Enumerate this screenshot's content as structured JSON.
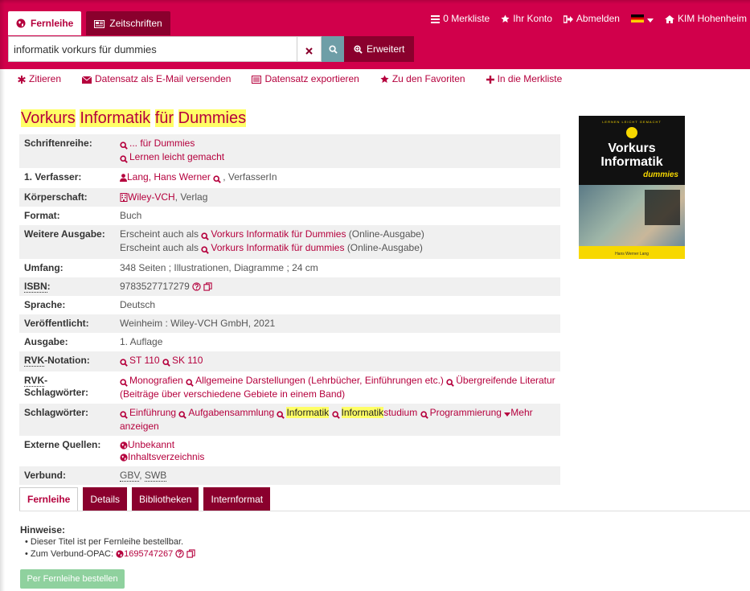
{
  "header": {
    "tab_fernleihe": "Fernleihe",
    "tab_zeitschriften": "Zeitschriften",
    "merkliste": "0 Merkliste",
    "konto": "Ihr Konto",
    "abmelden": "Abmelden",
    "kim": "KIM Hohenheim"
  },
  "search": {
    "value": "informatik vorkurs für dummies",
    "advanced": "Erweitert"
  },
  "actions": {
    "zitieren": "Zitieren",
    "email": "Datensatz als E-Mail versenden",
    "export": "Datensatz exportieren",
    "favoriten": "Zu den Favoriten",
    "merkliste": "In die Merkliste"
  },
  "title": {
    "w1": "Vorkurs",
    "w2": "Informatik",
    "w3": "für",
    "w4": "Dummies"
  },
  "record": {
    "schriftenreihe_label": "Schriftenreihe:",
    "schriftenreihe_1": "... für Dummies",
    "schriftenreihe_2": "Lernen leicht gemacht",
    "verfasser_label": "1. Verfasser:",
    "verfasser_name": "Lang, Hans Werner",
    "verfasser_role": ", VerfasserIn",
    "koerperschaft_label": "Körperschaft:",
    "koerperschaft_name": "Wiley-VCH",
    "koerperschaft_role": ", Verlag",
    "format_label": "Format:",
    "format": "Buch",
    "weitere_label": "Weitere Ausgabe:",
    "weitere_prefix": "Erscheint auch als",
    "weitere_1": "Vorkurs Informatik für Dummies",
    "weitere_2": "Vorkurs Informatik für dummies",
    "weitere_suffix": "(Online-Ausgabe)",
    "umfang_label": "Umfang:",
    "umfang": "348 Seiten ; Illustrationen, Diagramme ; 24 cm",
    "isbn_label": "ISBN",
    "isbn": "9783527717279",
    "sprache_label": "Sprache:",
    "sprache": "Deutsch",
    "veroeff_label": "Veröffentlicht:",
    "veroeff": "Weinheim : Wiley-VCH GmbH, 2021",
    "ausgabe_label": "Ausgabe:",
    "ausgabe": "1. Auflage",
    "rvk_abbr": "RVK",
    "rvk_notation_suffix": "-Notation:",
    "rvk_1": "ST 110",
    "rvk_2": "SK 110",
    "rvk_schlag_suffix": "-Schlagwörter:",
    "rvks_1": "Monografien",
    "rvks_2": "Allgemeine Darstellungen (Lehrbücher, Einführungen etc.)",
    "rvks_3": "Übergreifende Literatur",
    "rvks_3b": "(Beiträge über verschiedene Gebiete in einem Band)",
    "schlag_label": "Schlagwörter:",
    "sw_1": "Einführung",
    "sw_2": "Aufgabensammlung",
    "sw_3": "Informatik",
    "sw_4a": "Informatik",
    "sw_4b": "studium",
    "sw_5": "Programmierung",
    "sw_more_1": "Mehr",
    "sw_more_2": "anzeigen",
    "extern_label": "Externe Quellen:",
    "extern_1": "Unbekannt",
    "extern_2": "Inhaltsverzeichnis",
    "verbund_label": "Verbund:",
    "verbund_1": "GBV",
    "verbund_2": "SWB"
  },
  "cover": {
    "banner": "LERNEN LEICHT GEMACHT",
    "title_1": "Vorkurs",
    "title_2": "Informatik",
    "brand": "dummies",
    "author": "Hans Werner Lang"
  },
  "tabs": {
    "fernleihe": "Fernleihe",
    "details": "Details",
    "bibliotheken": "Bibliotheken",
    "internformat": "Internformat"
  },
  "hinweise": {
    "heading": "Hinweise:",
    "line_1": "Dieser Titel ist per Fernleihe bestellbar.",
    "line_2_prefix": "Zum Verbund-OPAC:",
    "opac_id": "1695747267"
  },
  "order_button": "Per Fernleihe bestellen",
  "colors": {
    "brand": "#d1004b",
    "dark": "#8a002d",
    "link": "#b5003d",
    "highlight": "#ffff66",
    "order": "#8fd19e"
  }
}
